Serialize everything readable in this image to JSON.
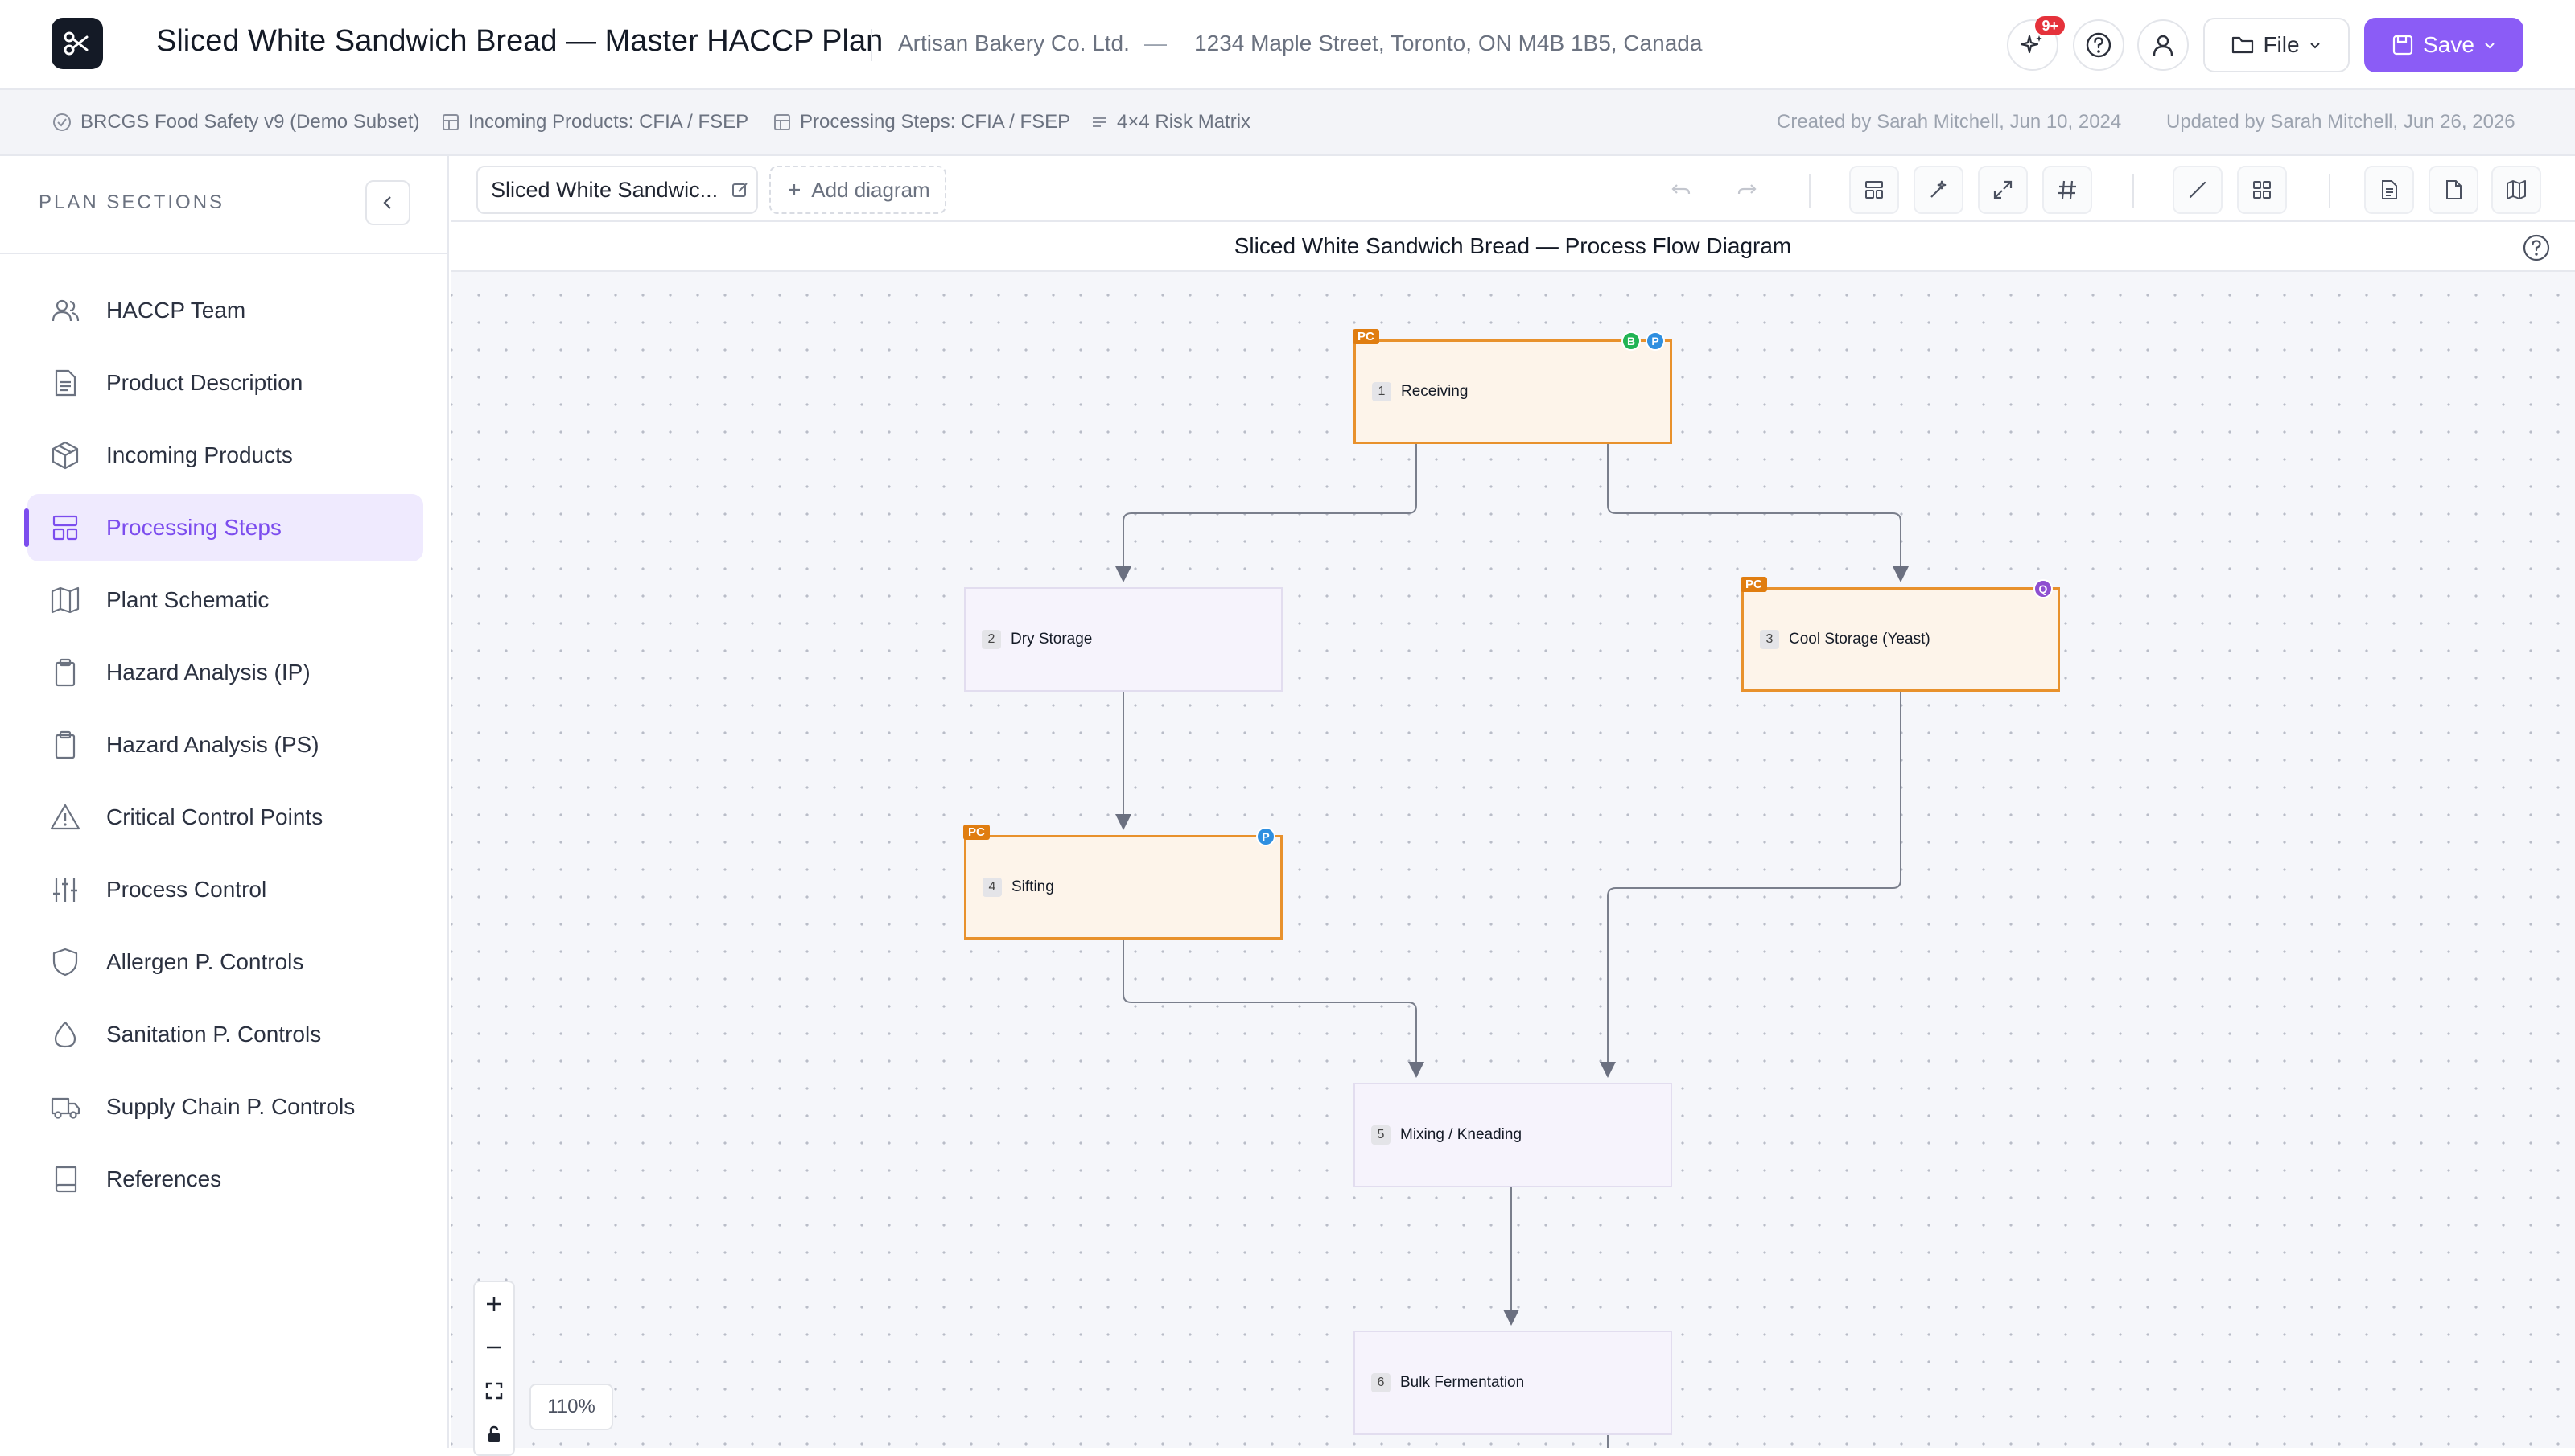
{
  "header": {
    "title": "Sliced White Sandwich Bread — Master HACCP Plan",
    "company": "Artisan Bakery Co. Ltd.",
    "separator": "—",
    "address": "1234 Maple Street, Toronto, ON M4B 1B5, Canada",
    "notification_badge": "9+",
    "file_label": "File",
    "save_label": "Save",
    "accent": "#8b5cf6"
  },
  "subbar": {
    "standard": "BRCGS Food Safety v9 (Demo Subset)",
    "incoming": "Incoming Products: CFIA / FSEP",
    "processing": "Processing Steps: CFIA / FSEP",
    "matrix": "4×4 Risk Matrix",
    "created": "Created by Sarah Mitchell, Jun 10, 2024",
    "updated": "Updated by Sarah Mitchell, Jun 26, 2026"
  },
  "sidebar": {
    "heading": "PLAN SECTIONS",
    "items": [
      {
        "label": "HACCP Team",
        "icon": "users-icon"
      },
      {
        "label": "Product Description",
        "icon": "document-icon"
      },
      {
        "label": "Incoming Products",
        "icon": "package-icon"
      },
      {
        "label": "Processing Steps",
        "icon": "layout-icon",
        "active": true
      },
      {
        "label": "Plant Schematic",
        "icon": "map-icon"
      },
      {
        "label": "Hazard Analysis (IP)",
        "icon": "clipboard-icon"
      },
      {
        "label": "Hazard Analysis (PS)",
        "icon": "clipboard-icon"
      },
      {
        "label": "Critical Control Points",
        "icon": "warning-icon"
      },
      {
        "label": "Process Control",
        "icon": "sliders-icon"
      },
      {
        "label": "Allergen P. Controls",
        "icon": "shield-icon"
      },
      {
        "label": "Sanitation P. Controls",
        "icon": "droplet-icon"
      },
      {
        "label": "Supply Chain P. Controls",
        "icon": "truck-icon"
      },
      {
        "label": "References",
        "icon": "book-icon"
      }
    ]
  },
  "toolbar": {
    "tab_label": "Sliced White Sandwic...",
    "add_diagram": "Add diagram"
  },
  "diagram": {
    "title": "Sliced White Sandwich Bread — Process Flow Diagram",
    "zoom": "110%",
    "nodes": [
      {
        "num": "1",
        "label": "Receiving",
        "pc": true,
        "tag": "PC",
        "badges": [
          {
            "letter": "B",
            "color": "#22b455"
          },
          {
            "letter": "P",
            "color": "#2f8fe0"
          }
        ]
      },
      {
        "num": "2",
        "label": "Dry Storage",
        "pc": false,
        "tag": "",
        "badges": []
      },
      {
        "num": "3",
        "label": "Cool Storage (Yeast)",
        "pc": true,
        "tag": "PC",
        "badges": [
          {
            "letter": "Q",
            "color": "#8e4fd0"
          }
        ]
      },
      {
        "num": "4",
        "label": "Sifting",
        "pc": true,
        "tag": "PC",
        "badges": [
          {
            "letter": "P",
            "color": "#2f8fe0"
          }
        ]
      },
      {
        "num": "5",
        "label": "Mixing / Kneading",
        "pc": false,
        "tag": "",
        "badges": []
      },
      {
        "num": "6",
        "label": "Bulk Fermentation",
        "pc": false,
        "tag": "",
        "badges": []
      }
    ]
  }
}
